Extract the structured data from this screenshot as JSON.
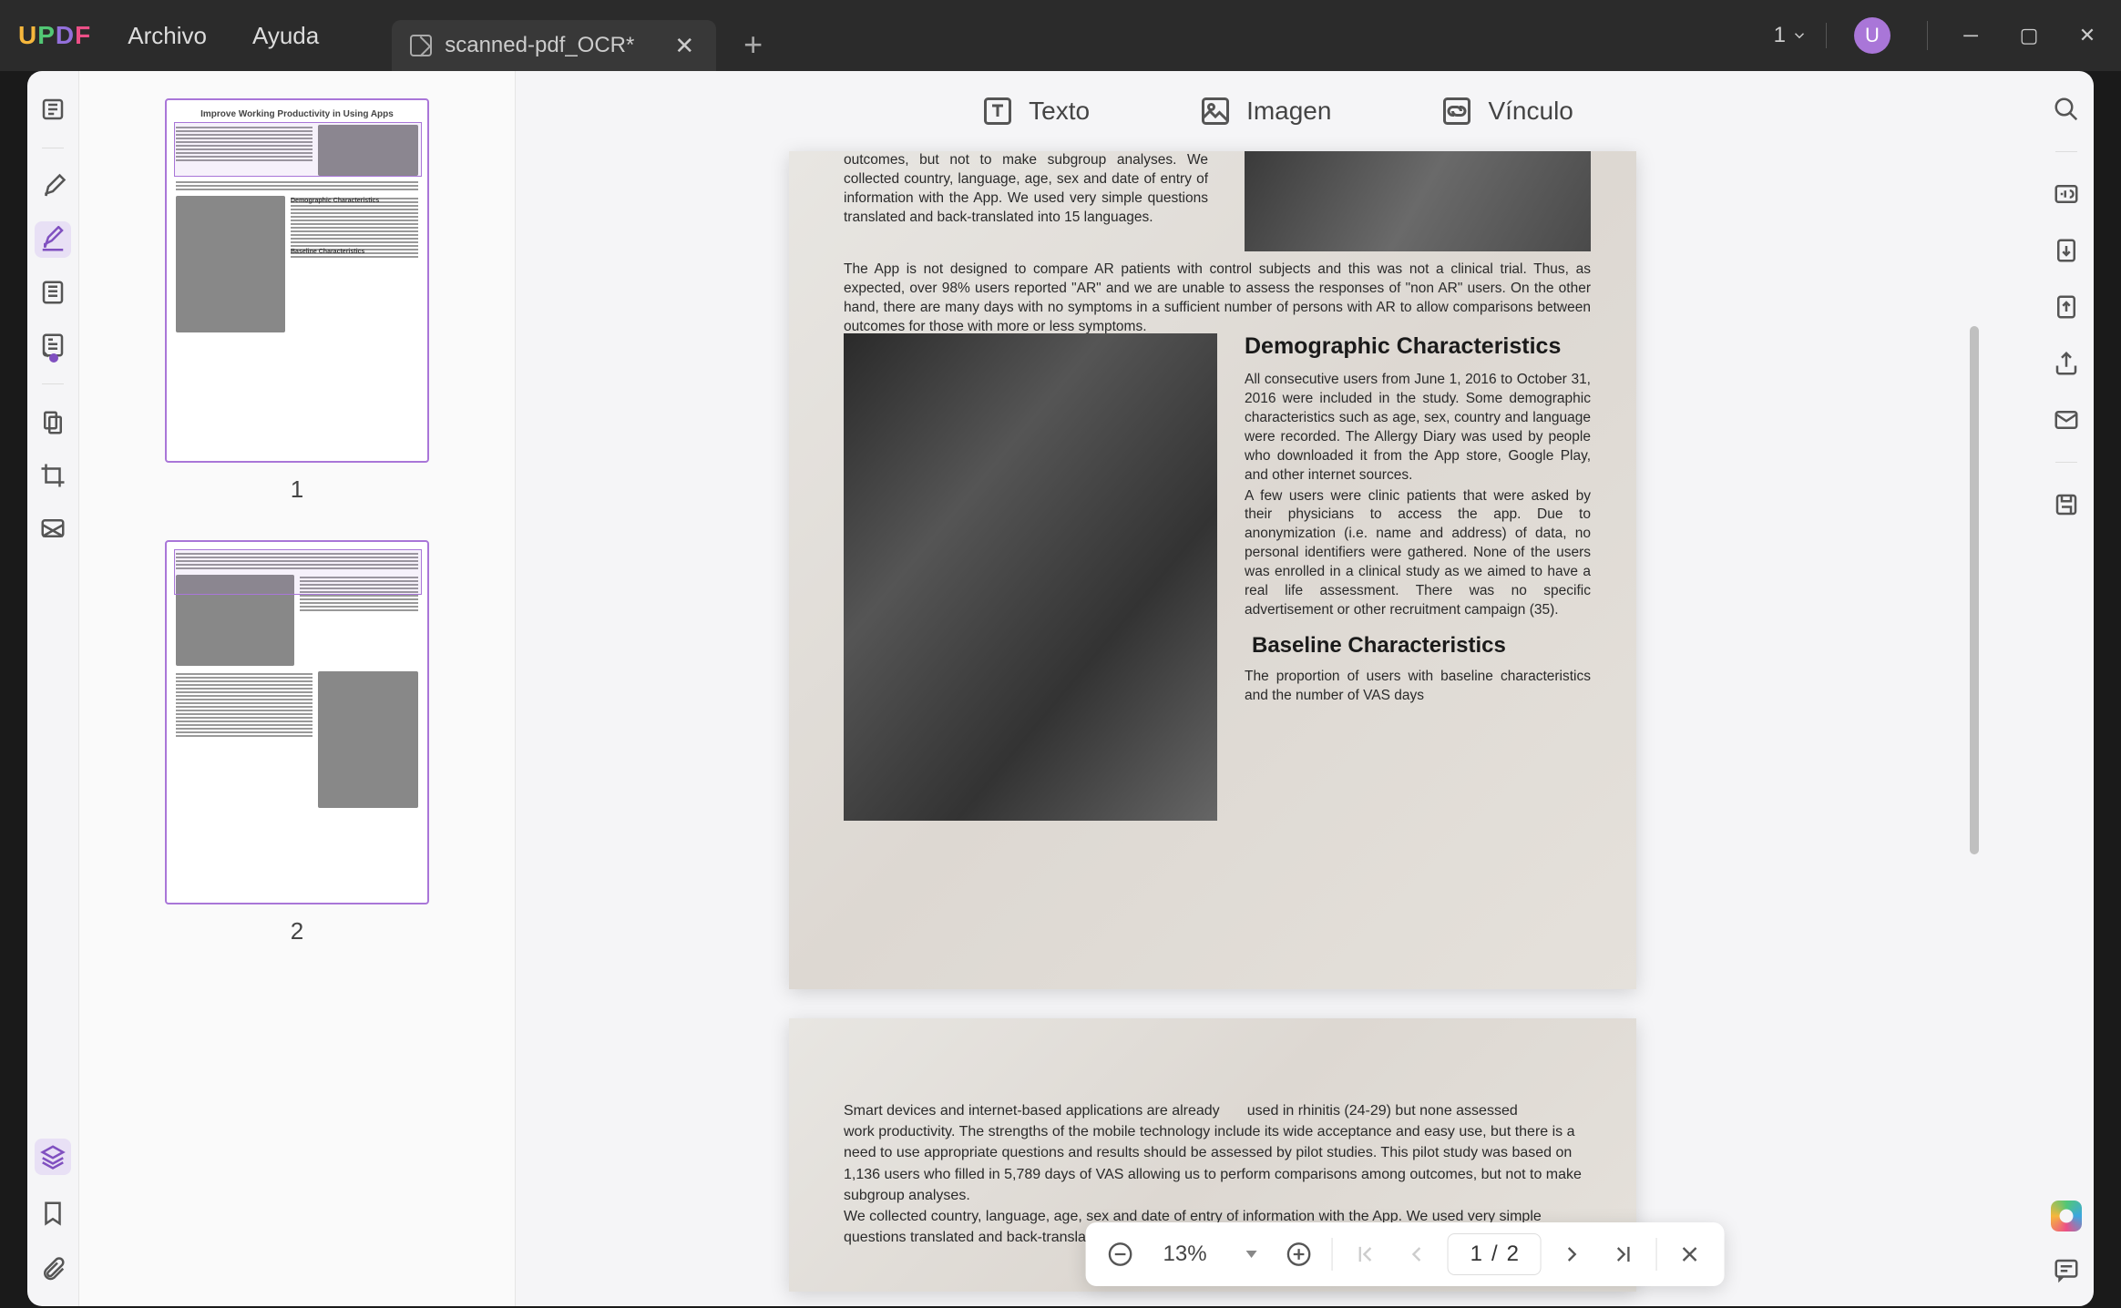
{
  "app": {
    "logo": "UPDF",
    "menu": {
      "file": "Archivo",
      "help": "Ayuda"
    },
    "tab_title": "scanned-pdf_OCR*",
    "page_dd": "1",
    "avatar_letter": "U"
  },
  "edit_bar": {
    "text": "Texto",
    "image": "Imagen",
    "link": "Vínculo"
  },
  "thumbs": {
    "p1": "1",
    "p2": "2",
    "p1_title": "Improve Working Productivity in Using Apps",
    "p1_h1": "Demographic Characteristics",
    "p1_h2": "Baseline Characteristics"
  },
  "doc": {
    "p1_a": "outcomes, but not to make subgroup analyses. We collected country, language, age, sex and date of entry of information with the App. We used very simple questions translated and back-translated into 15 languages.",
    "p1_b": "The App is not designed to compare AR patients with control subjects and this was not a clinical trial. Thus, as expected, over 98% users reported \"AR\" and we are unable to assess the responses of \"non AR\" users. On the other hand, there are many days with no symptoms in a sufficient number of persons with AR to allow comparisons between outcomes for those with more or less symptoms.",
    "p1_h1": "Demographic Characteristics",
    "p1_c": "All consecutive users from June 1, 2016 to October 31, 2016 were included in the study. Some demographic characteristics such as age, sex, country and language were recorded. The Allergy Diary was used by people who downloaded it from the App store, Google Play, and other internet sources.",
    "p1_d": "A few users were clinic patients that were asked by their physicians to access the app. Due to anonymization (i.e. name and address) of data, no personal identifiers were gathered. None of the users was enrolled in a clinical study as we aimed to have a real life assessment. There was no specific advertisement or other recruitment campaign (35).",
    "p1_h2": "Baseline Characteristics",
    "p1_e": "The proportion of users with baseline characteristics and the number of VAS days",
    "p2_a": "Smart devices and internet-based applications are already",
    "p2_b": "used in rhinitis (24-29) but none assessed",
    "p2_c": "work productivity. The strengths of the mobile technology include its wide acceptance and easy use, but there is a need to use appropriate questions and results should be assessed by pilot studies. This pilot study was based on 1,136 users who filled in 5,789 days of VAS allowing us to perform comparisons among outcomes, but not to make subgroup analyses.",
    "p2_d": "We collected country, language, age, sex and date of entry of information with the App. We used very simple questions translated and back-translated into 15 languages."
  },
  "footer": {
    "zoom": "13%",
    "page_cur": "1",
    "page_sep": "/",
    "page_tot": "2"
  }
}
